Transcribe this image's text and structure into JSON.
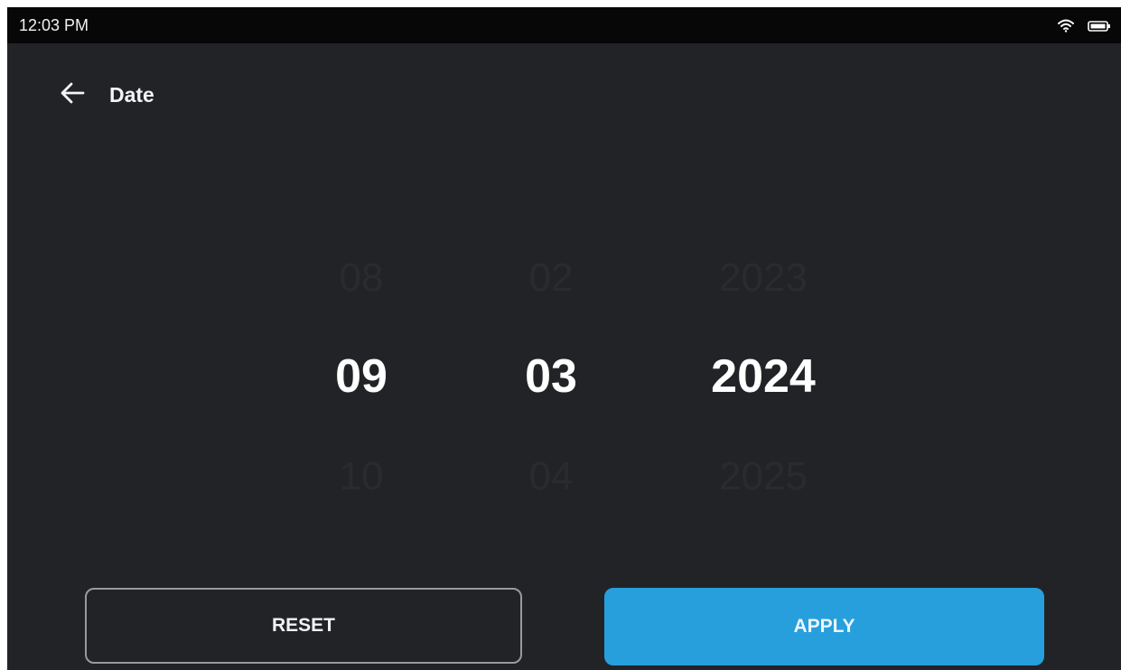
{
  "status_bar": {
    "time": "12:03 PM"
  },
  "header": {
    "title": "Date"
  },
  "picker": {
    "month": {
      "previous": "08",
      "selected": "09",
      "next": "10"
    },
    "day": {
      "previous": "02",
      "selected": "03",
      "next": "04"
    },
    "year": {
      "previous": "2023",
      "selected": "2024",
      "next": "2025"
    }
  },
  "actions": {
    "reset_label": "RESET",
    "apply_label": "APPLY"
  },
  "colors": {
    "background": "#222327",
    "status_bar": "#070708",
    "accent": "#289fdd",
    "inactive_value": "#2a2b2f",
    "selected_value": "#ffffff",
    "outline": "#9a9a9c"
  },
  "icons": {
    "back": "arrow-left-icon",
    "wifi": "wifi-icon",
    "battery": "battery-icon"
  }
}
